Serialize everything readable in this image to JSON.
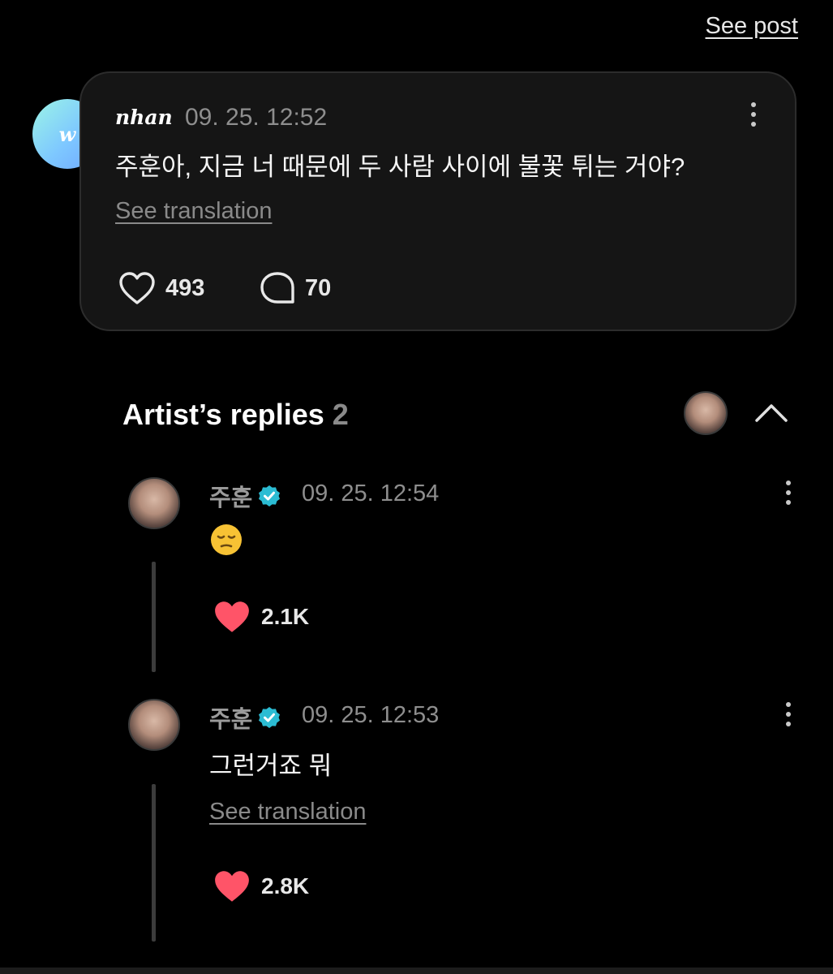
{
  "header": {
    "see_post_label": "See post"
  },
  "comment": {
    "username": "nhan",
    "avatar_letter": "w",
    "timestamp": "09. 25. 12:52",
    "text": "주훈아, 지금 너 때문에 두 사람 사이에 불꽃 튀는 거야?",
    "see_translation_label": "See translation",
    "likes": "493",
    "comments": "70"
  },
  "artist_replies": {
    "title": "Artist’s replies",
    "count": "2",
    "replies": [
      {
        "name": "주훈",
        "verified": true,
        "timestamp": "09. 25. 12:54",
        "content": "😔",
        "likes": "2.1K"
      },
      {
        "name": "주훈",
        "verified": true,
        "timestamp": "09. 25. 12:53",
        "content": "그런거죠 뭐",
        "see_translation_label": "See translation",
        "likes": "2.8K"
      }
    ]
  },
  "colors": {
    "background": "#000000",
    "card": "#151515",
    "like_red": "#ff5468",
    "verified": "#2bbcd3"
  }
}
